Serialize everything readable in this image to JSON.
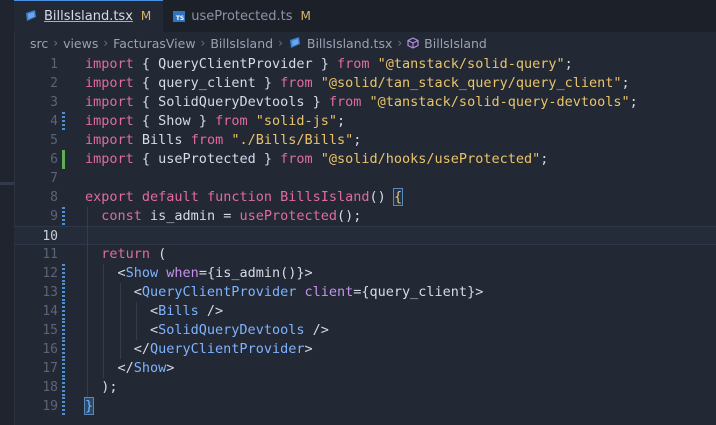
{
  "tabs": [
    {
      "name": "BillsIsland.tsx",
      "modified": "M",
      "icon": "react-icon",
      "active": true
    },
    {
      "name": "useProtected.ts",
      "modified": "M",
      "icon": "ts-icon",
      "active": false
    }
  ],
  "ts_badge": "TS",
  "breadcrumb": [
    "src",
    "views",
    "FacturasView",
    "BillsIsland",
    "BillsIsland.tsx",
    "BillsIsland"
  ],
  "current_line": 10,
  "lines": [
    {
      "n": "1",
      "mark": "",
      "tokens": [
        [
          "kw",
          "import"
        ],
        [
          "br",
          " { "
        ],
        [
          "id",
          "QueryClientProvider"
        ],
        [
          "br",
          " } "
        ],
        [
          "kw",
          "from"
        ],
        [
          "br",
          " "
        ],
        [
          "str",
          "\"@tanstack/solid-query\""
        ],
        [
          "br",
          ";"
        ]
      ]
    },
    {
      "n": "2",
      "mark": "",
      "tokens": [
        [
          "kw",
          "import"
        ],
        [
          "br",
          " { "
        ],
        [
          "id",
          "query_client"
        ],
        [
          "br",
          " } "
        ],
        [
          "kw",
          "from"
        ],
        [
          "br",
          " "
        ],
        [
          "str",
          "\"@solid/tan_stack_query/query_client\""
        ],
        [
          "br",
          ";"
        ]
      ]
    },
    {
      "n": "3",
      "mark": "",
      "tokens": [
        [
          "kw",
          "import"
        ],
        [
          "br",
          " { "
        ],
        [
          "id",
          "SolidQueryDevtools"
        ],
        [
          "br",
          " } "
        ],
        [
          "kw",
          "from"
        ],
        [
          "br",
          " "
        ],
        [
          "str",
          "\"@tanstack/solid-query-devtools\""
        ],
        [
          "br",
          ";"
        ]
      ]
    },
    {
      "n": "4",
      "mark": "mod",
      "tokens": [
        [
          "kw",
          "import"
        ],
        [
          "br",
          " { "
        ],
        [
          "id",
          "Show"
        ],
        [
          "br",
          " } "
        ],
        [
          "kw",
          "from"
        ],
        [
          "br",
          " "
        ],
        [
          "str",
          "\"solid-js\""
        ],
        [
          "br",
          ";"
        ]
      ]
    },
    {
      "n": "5",
      "mark": "",
      "tokens": [
        [
          "kw",
          "import"
        ],
        [
          "br",
          " "
        ],
        [
          "id",
          "Bills"
        ],
        [
          "br",
          " "
        ],
        [
          "kw",
          "from"
        ],
        [
          "br",
          " "
        ],
        [
          "str",
          "\"./Bills/Bills\""
        ],
        [
          "br",
          ";"
        ]
      ]
    },
    {
      "n": "6",
      "mark": "add",
      "tokens": [
        [
          "kw",
          "import"
        ],
        [
          "br",
          " { "
        ],
        [
          "id",
          "useProtected"
        ],
        [
          "br",
          " } "
        ],
        [
          "kw",
          "from"
        ],
        [
          "br",
          " "
        ],
        [
          "str",
          "\"@solid/hooks/useProtected\""
        ],
        [
          "br",
          ";"
        ]
      ]
    },
    {
      "n": "7",
      "mark": "",
      "tokens": []
    },
    {
      "n": "8",
      "mark": "",
      "tokens": [
        [
          "kw",
          "export"
        ],
        [
          "br",
          " "
        ],
        [
          "kw",
          "default"
        ],
        [
          "br",
          " "
        ],
        [
          "kw",
          "function"
        ],
        [
          "br",
          " "
        ],
        [
          "fn",
          "BillsIsland"
        ],
        [
          "br",
          "() "
        ],
        [
          "brace-hl",
          "{"
        ]
      ]
    },
    {
      "n": "9",
      "mark": "mod",
      "tokens": [
        [
          "br",
          "  "
        ],
        [
          "kw",
          "const"
        ],
        [
          "br",
          " "
        ],
        [
          "id",
          "is_admin"
        ],
        [
          "br",
          " = "
        ],
        [
          "fn",
          "useProtected"
        ],
        [
          "br",
          "();"
        ]
      ]
    },
    {
      "n": "10",
      "mark": "",
      "tokens": []
    },
    {
      "n": "11",
      "mark": "",
      "tokens": [
        [
          "br",
          "  "
        ],
        [
          "kw",
          "return"
        ],
        [
          "br",
          " ("
        ]
      ]
    },
    {
      "n": "12",
      "mark": "mod",
      "tokens": [
        [
          "br",
          "    <"
        ],
        [
          "tag",
          "Show"
        ],
        [
          "br",
          " "
        ],
        [
          "attr",
          "when"
        ],
        [
          "br",
          "={"
        ],
        [
          "id",
          "is_admin"
        ],
        [
          "br",
          "()}>"
        ]
      ]
    },
    {
      "n": "13",
      "mark": "mod",
      "tokens": [
        [
          "br",
          "      <"
        ],
        [
          "tag",
          "QueryClientProvider"
        ],
        [
          "br",
          " "
        ],
        [
          "attr",
          "client"
        ],
        [
          "br",
          "={"
        ],
        [
          "id",
          "query_client"
        ],
        [
          "br",
          "}>"
        ]
      ]
    },
    {
      "n": "14",
      "mark": "mod",
      "tokens": [
        [
          "br",
          "        <"
        ],
        [
          "tag",
          "Bills"
        ],
        [
          "br",
          " />"
        ]
      ]
    },
    {
      "n": "15",
      "mark": "mod",
      "tokens": [
        [
          "br",
          "        <"
        ],
        [
          "tag",
          "SolidQueryDevtools"
        ],
        [
          "br",
          " />"
        ]
      ]
    },
    {
      "n": "16",
      "mark": "mod",
      "tokens": [
        [
          "br",
          "      </"
        ],
        [
          "tag",
          "QueryClientProvider"
        ],
        [
          "br",
          ">"
        ]
      ]
    },
    {
      "n": "17",
      "mark": "mod",
      "tokens": [
        [
          "br",
          "    </"
        ],
        [
          "tag",
          "Show"
        ],
        [
          "br",
          ">"
        ]
      ]
    },
    {
      "n": "18",
      "mark": "mod",
      "tokens": [
        [
          "br",
          "  );"
        ]
      ]
    },
    {
      "n": "19",
      "mark": "mod",
      "tokens": [
        [
          "brace-hl2",
          "}"
        ]
      ]
    }
  ]
}
